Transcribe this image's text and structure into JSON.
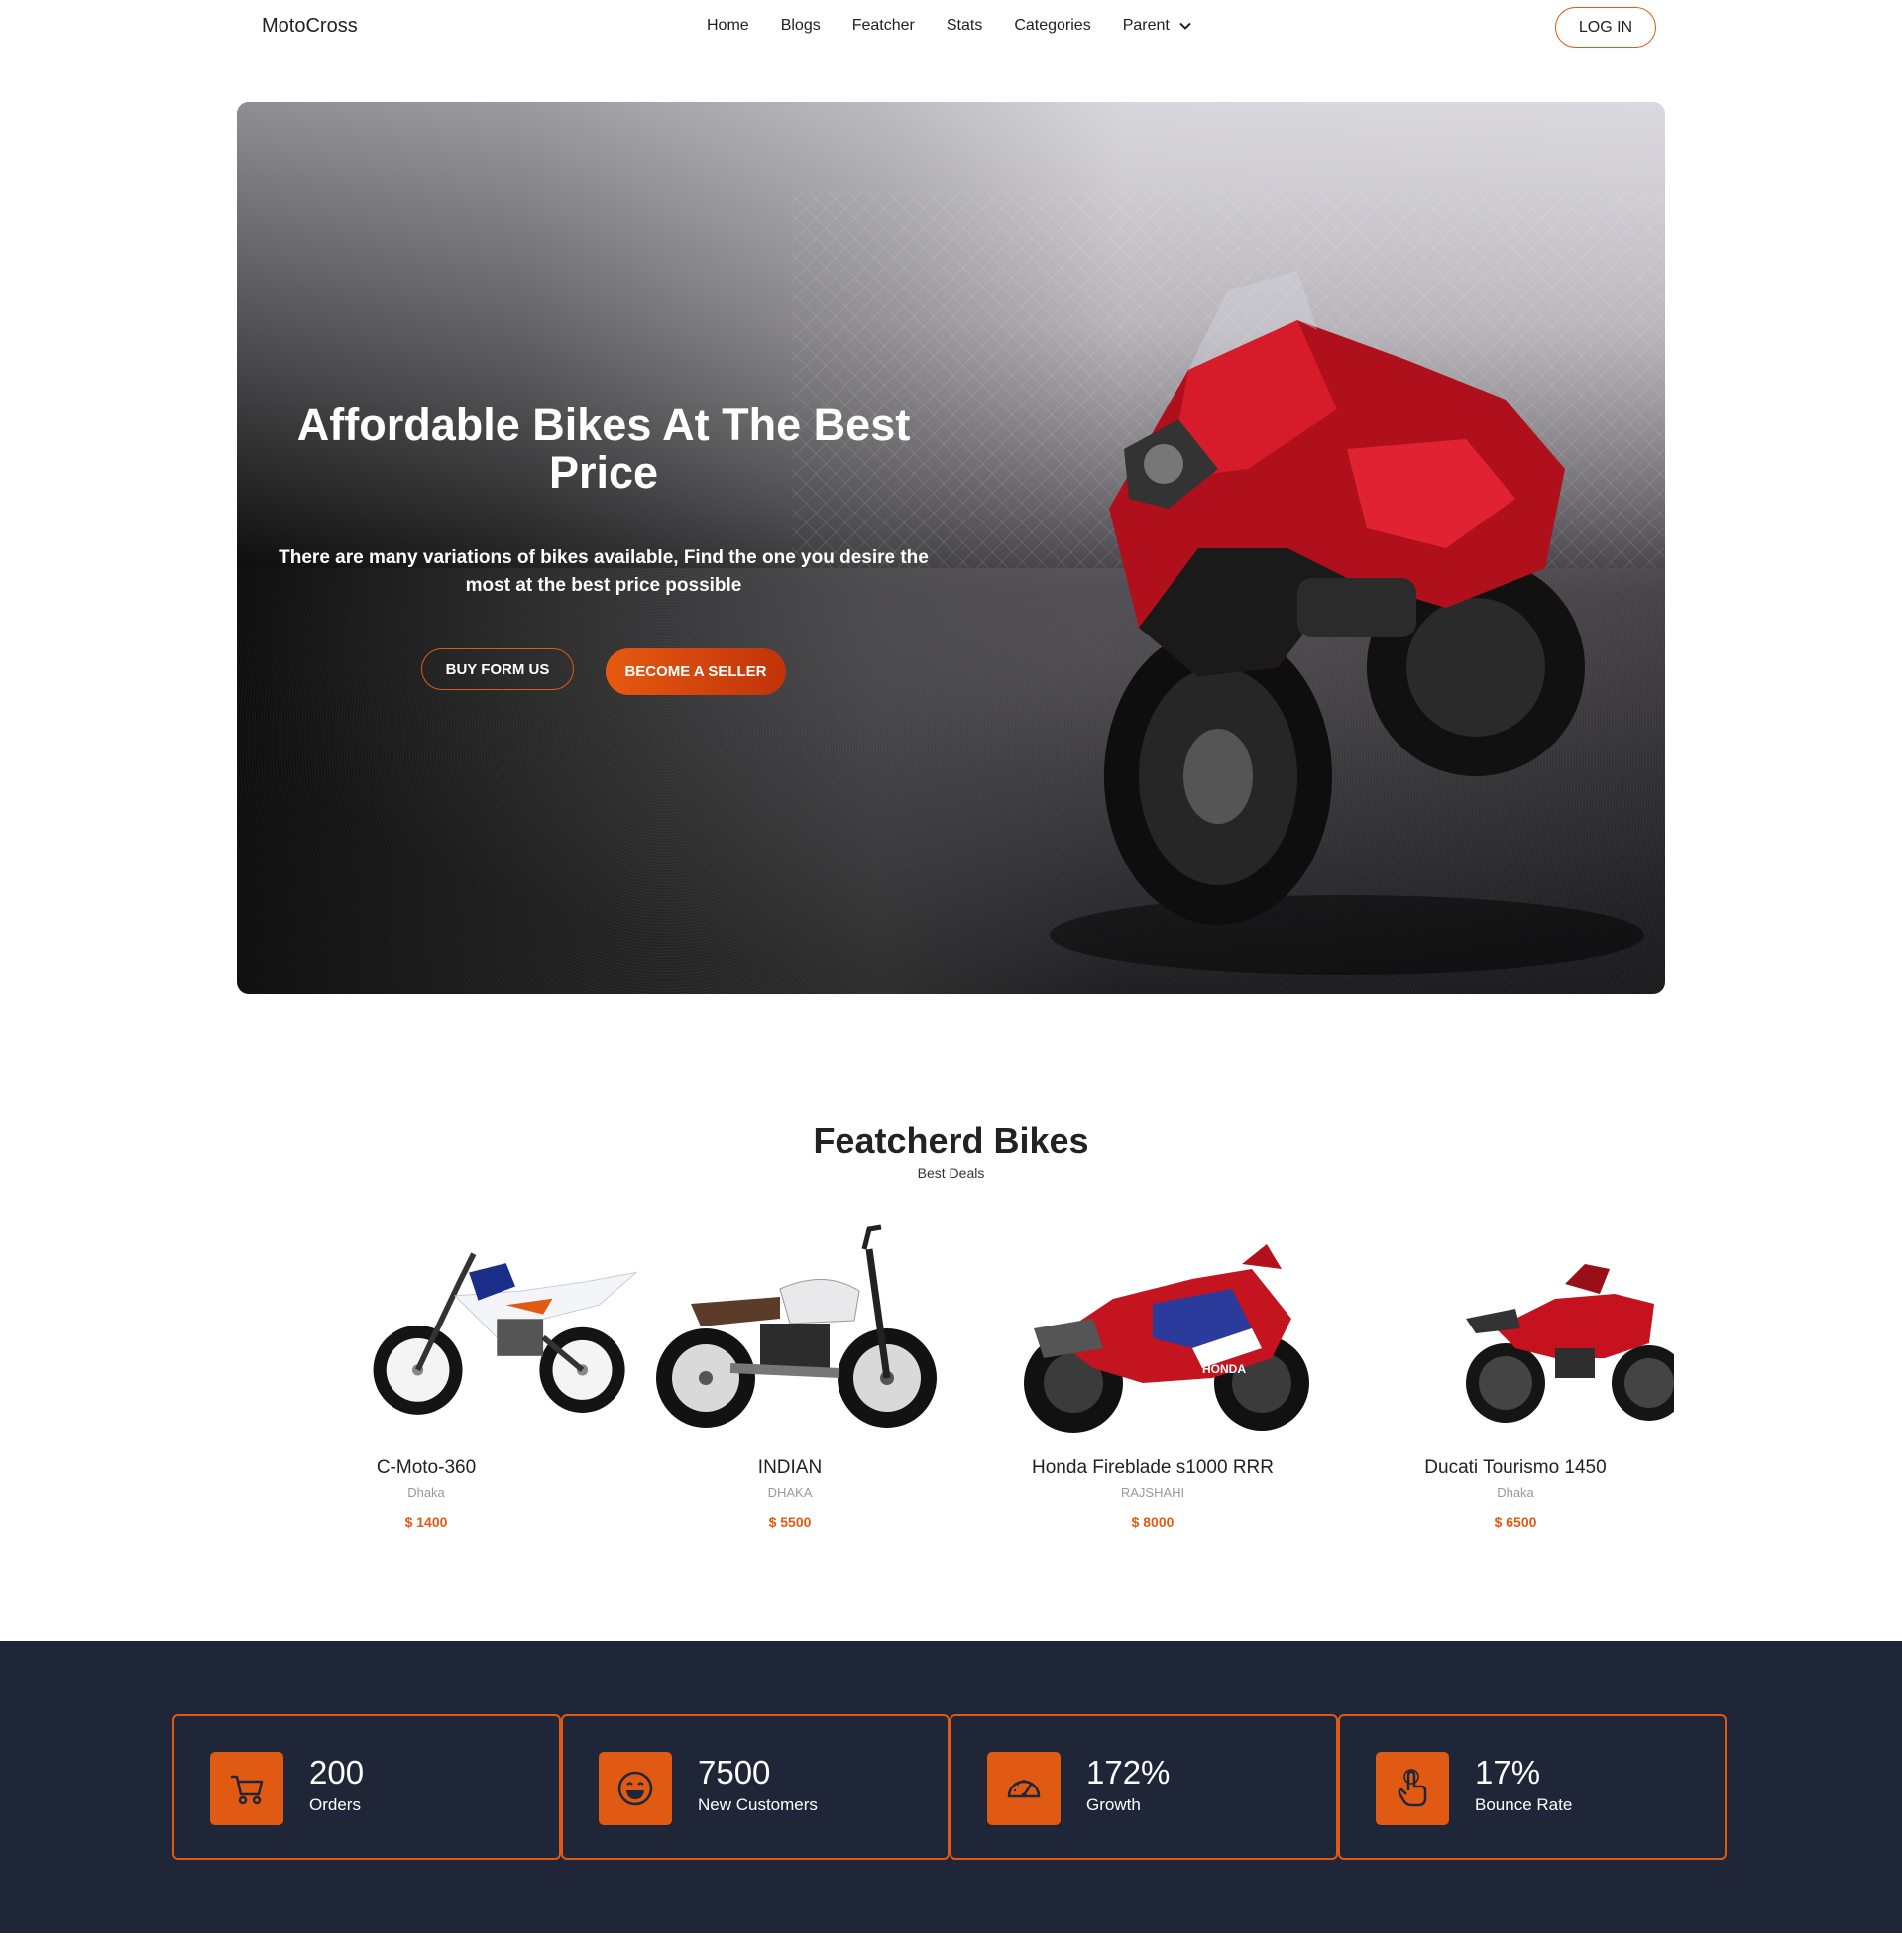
{
  "nav": {
    "brand": "MotoCross",
    "links": [
      "Home",
      "Blogs",
      "Featcher",
      "Stats",
      "Categories",
      "Parent"
    ],
    "login": "LOG IN"
  },
  "hero": {
    "title": "Affordable Bikes At The Best Price",
    "subtitle": "There are many variations of bikes available, Find the one you desire the most at the best price possible",
    "buy_button": "BUY FORM US",
    "seller_button": "BECOME A SELLER"
  },
  "featured": {
    "title": "Featcherd Bikes",
    "subtitle": "Best Deals",
    "bikes": [
      {
        "name": "C-Moto-360",
        "location": "Dhaka",
        "price": "$ 1400"
      },
      {
        "name": "INDIAN",
        "location": "DHAKA",
        "price": "$ 5500"
      },
      {
        "name": "Honda Fireblade s1000 RRR",
        "location": "RAJSHAHI",
        "price": "$ 8000"
      },
      {
        "name": "Ducati Tourismo 1450",
        "location": "Dhaka",
        "price": "$ 6500"
      }
    ]
  },
  "stats": [
    {
      "value": "200",
      "label": "Orders",
      "icon": "cart-icon"
    },
    {
      "value": "7500",
      "label": "New Customers",
      "icon": "smiley-icon"
    },
    {
      "value": "172%",
      "label": "Growth",
      "icon": "speedometer-icon"
    },
    {
      "value": "17%",
      "label": "Bounce Rate",
      "icon": "pointer-hand-icon"
    }
  ],
  "colors": {
    "accent": "#e05a13",
    "stats_bg": "#1f2637"
  }
}
